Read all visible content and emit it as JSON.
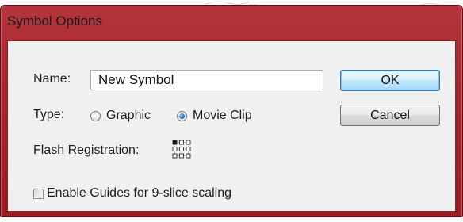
{
  "dialog": {
    "title": "Symbol Options"
  },
  "name_field": {
    "label": "Name:",
    "value": "New Symbol"
  },
  "type_group": {
    "label": "Type:",
    "options": [
      {
        "label": "Graphic",
        "checked": false
      },
      {
        "label": "Movie Clip",
        "checked": true
      }
    ]
  },
  "registration": {
    "label": "Flash Registration:",
    "selected_point": "top-left"
  },
  "guides": {
    "label": "Enable Guides for 9-slice scaling",
    "checked": false
  },
  "buttons": {
    "ok": "OK",
    "cancel": "Cancel"
  },
  "colors": {
    "titlebar": "#a8262d",
    "client": "#f0f0f0",
    "default_button": "#bee6fd"
  }
}
